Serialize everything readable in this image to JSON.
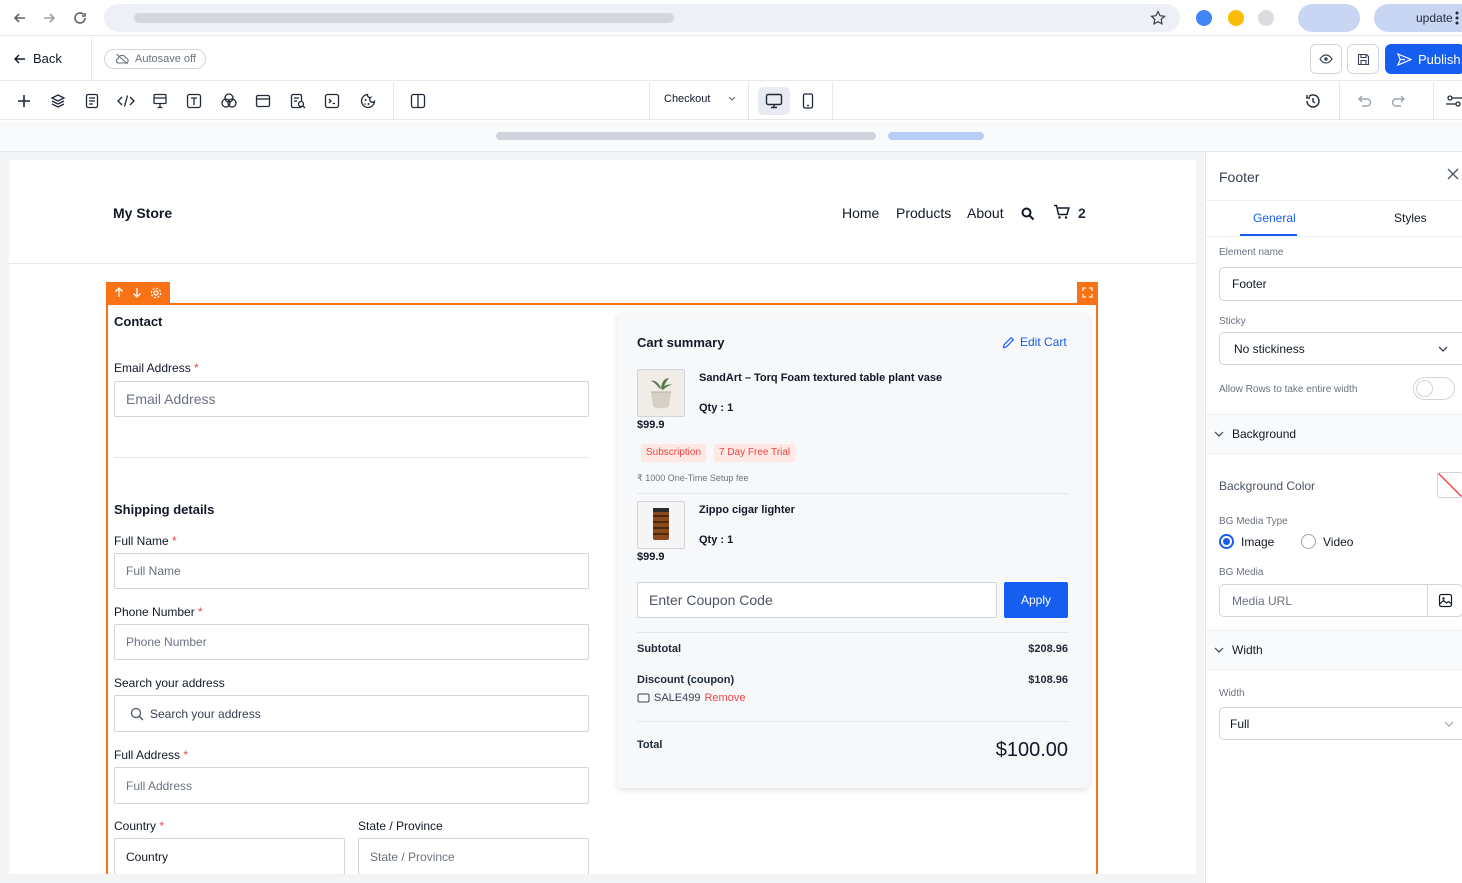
{
  "browser": {
    "update_label": "update",
    "icons": [
      "back-arrow-icon",
      "forward-arrow-icon",
      "reload-icon",
      "star-icon",
      "kebab-menu-icon"
    ]
  },
  "header": {
    "back_label": "Back",
    "autosave_label": "Autosave off",
    "publish_label": "Publish"
  },
  "toolbar": {
    "page_select": "Checkout"
  },
  "store": {
    "name": "My Store",
    "nav": [
      "Home",
      "Products",
      "About"
    ],
    "cart_count": "2"
  },
  "contact": {
    "title": "Contact",
    "email_label": "Email Address",
    "email_placeholder": "Email Address"
  },
  "shipping": {
    "title": "Shipping details",
    "full_name_label": "Full Name",
    "full_name_placeholder": "Full Name",
    "phone_label": "Phone Number",
    "phone_placeholder": "Phone Number",
    "search_label": "Search your address",
    "search_placeholder": "Search your address",
    "address_label": "Full Address",
    "address_placeholder": "Full Address",
    "country_label": "Country",
    "country_value": "Country",
    "state_label": "State / Province",
    "state_placeholder": "State / Province"
  },
  "cart": {
    "title": "Cart summary",
    "edit_label": "Edit Cart",
    "items": [
      {
        "name": "SandArt – Torq Foam textured table plant vase",
        "qty": "Qty : 1",
        "price": "$99.9",
        "tags": [
          "Subscription",
          "7 Day Free Trial"
        ],
        "fee": "₹ 1000 One-Time Setup fee"
      },
      {
        "name": "Zippo cigar lighter",
        "qty": "Qty : 1",
        "price": "$99.9"
      }
    ],
    "coupon_placeholder": "Enter Coupon Code",
    "apply_label": "Apply",
    "subtotal_label": "Subtotal",
    "subtotal_value": "$208.96",
    "discount_label": "Discount (coupon)",
    "discount_value": "$108.96",
    "coupon_code": "SALE499",
    "remove_label": "Remove",
    "total_label": "Total",
    "total_value": "$100.00"
  },
  "panel": {
    "title": "Footer",
    "tabs": [
      "General",
      "Styles"
    ],
    "element_name_label": "Element name",
    "element_name_value": "Footer",
    "sticky_label": "Sticky",
    "sticky_value": "No stickiness",
    "rows_label": "Allow Rows to take entire width",
    "background_group": "Background",
    "bg_color_label": "Background Color",
    "bg_media_type_label": "BG Media Type",
    "media_options": [
      "Image",
      "Video"
    ],
    "bg_media_label": "BG Media",
    "media_placeholder": "Media URL",
    "width_group": "Width",
    "width_label": "Width",
    "width_value": "Full"
  },
  "colors": {
    "accent": "#155eef",
    "selection": "#f97316",
    "required": "#ef4444"
  }
}
